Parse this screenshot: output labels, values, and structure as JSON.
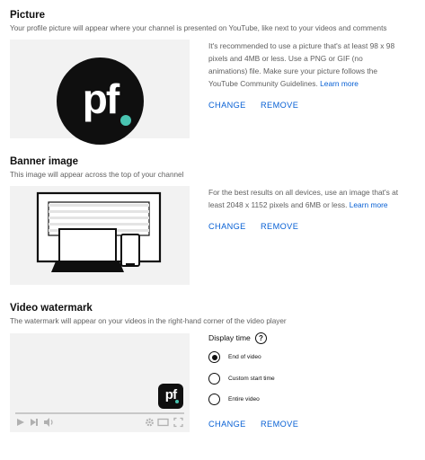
{
  "picture": {
    "title": "Picture",
    "description": "Your profile picture will appear where your channel is presented on YouTube, like next to your videos and comments",
    "info_lines": [
      "It's recommended to use a picture that's at least 98 x 98",
      "pixels and 4MB or less. Use a PNG or GIF (no",
      "animations) file. Make sure your picture follows the",
      "YouTube Community Guidelines."
    ],
    "learn_more": "Learn more",
    "change_label": "CHANGE",
    "remove_label": "REMOVE",
    "logo_text": "pf"
  },
  "banner": {
    "title": "Banner image",
    "description": "This image will appear across the top of your channel",
    "info_lines": [
      "For the best results on all devices, use an image that's at",
      "least 2048 x 1152 pixels and 6MB or less."
    ],
    "learn_more": "Learn more",
    "change_label": "CHANGE",
    "remove_label": "REMOVE"
  },
  "watermark": {
    "title": "Video watermark",
    "description": "The watermark will appear on your videos in the right-hand corner of the video player",
    "display_time_label": "Display time",
    "help_icon": "?",
    "logo_text": "pf",
    "options": [
      {
        "label": "End of video",
        "selected": true
      },
      {
        "label": "Custom start time",
        "selected": false
      },
      {
        "label": "Entire video",
        "selected": false
      }
    ],
    "change_label": "CHANGE",
    "remove_label": "REMOVE"
  },
  "colors": {
    "accent": "#065fd4",
    "logo_dot": "#49c4b1"
  }
}
